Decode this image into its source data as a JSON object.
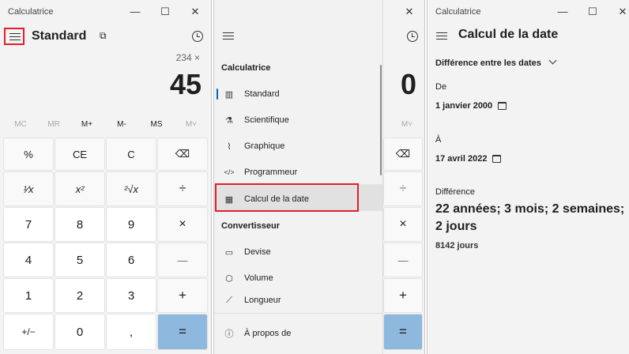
{
  "app_title": "Calculatrice",
  "window_controls": {
    "minimize": "—",
    "maximize": "☐",
    "close": "✕"
  },
  "left": {
    "mode": "Standard",
    "expression": "234 ×",
    "display": "45",
    "memory": [
      "MC",
      "MR",
      "M+",
      "M-",
      "MS",
      "M˅"
    ],
    "keys": [
      [
        "%",
        "CE",
        "C",
        "⌫"
      ],
      [
        "¹⁄x",
        "x²",
        "²√x",
        "÷"
      ],
      [
        "7",
        "8",
        "9",
        "×"
      ],
      [
        "4",
        "5",
        "6",
        "—"
      ],
      [
        "1",
        "2",
        "3",
        "+"
      ],
      [
        "+/−",
        "0",
        ",",
        "="
      ]
    ]
  },
  "middle": {
    "display": "0",
    "memory_last": "M˅",
    "visible_ops": [
      "⌫",
      "÷",
      "×",
      "—",
      "+",
      "="
    ],
    "menu": {
      "section1": "Calculatrice",
      "items1": [
        {
          "label": "Standard",
          "icon": "calculator-icon",
          "glyph": "▥"
        },
        {
          "label": "Scientifique",
          "icon": "flask-icon",
          "glyph": "⚗"
        },
        {
          "label": "Graphique",
          "icon": "graph-icon",
          "glyph": "⌇"
        },
        {
          "label": "Programmeur",
          "icon": "code-icon",
          "glyph": "</>"
        },
        {
          "label": "Calcul de la date",
          "icon": "calendar-icon",
          "glyph": "▦"
        }
      ],
      "section2": "Convertisseur",
      "items2": [
        {
          "label": "Devise",
          "icon": "currency-icon",
          "glyph": "▭"
        },
        {
          "label": "Volume",
          "icon": "cube-icon",
          "glyph": "⬡"
        },
        {
          "label": "Longueur",
          "icon": "ruler-icon",
          "glyph": "⟋"
        }
      ],
      "about": {
        "label": "À propos de",
        "icon": "info-icon",
        "glyph": "ⓘ"
      }
    }
  },
  "right": {
    "title": "Calcul de la date",
    "mode_select": "Différence entre les dates",
    "from_label": "De",
    "from_date": "1 janvier 2000",
    "to_label": "À",
    "to_date": "17 avril 2022",
    "diff_label": "Différence",
    "diff_value": "22 années; 3 mois; 2 semaines; 2 jours",
    "diff_days": "8142 jours"
  },
  "colors": {
    "highlight_red": "#e0202a",
    "equals_blue": "#8fb8de",
    "accent_bar": "#0067c0"
  }
}
